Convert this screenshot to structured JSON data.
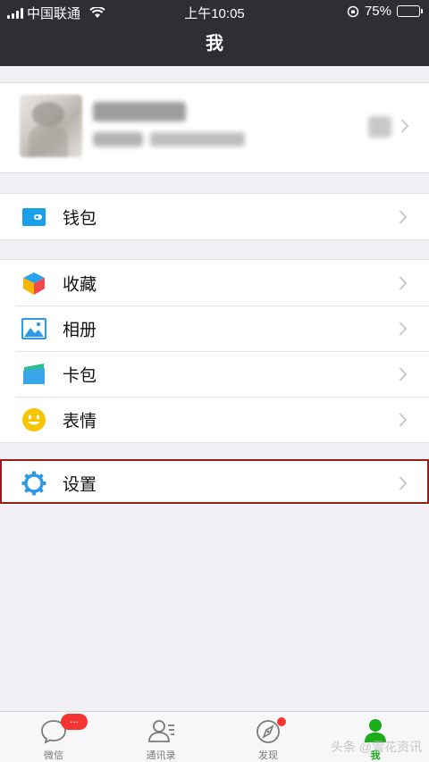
{
  "status_bar": {
    "carrier": "中国联通",
    "time": "上午10:05",
    "battery": "75%",
    "battery_level": 0.75
  },
  "nav": {
    "title": "我"
  },
  "profile": {},
  "groups": [
    {
      "items": [
        {
          "label": "钱包",
          "icon": "wallet-icon"
        }
      ]
    },
    {
      "items": [
        {
          "label": "收藏",
          "icon": "favorites-cube-icon"
        },
        {
          "label": "相册",
          "icon": "album-picture-icon"
        },
        {
          "label": "卡包",
          "icon": "card-holder-icon"
        },
        {
          "label": "表情",
          "icon": "smiley-face-icon"
        }
      ]
    },
    {
      "items": [
        {
          "label": "设置",
          "icon": "settings-gear-icon"
        }
      ]
    }
  ],
  "tabs": [
    {
      "label": "微信",
      "icon": "chat-bubble-icon",
      "badge": "..."
    },
    {
      "label": "通讯录",
      "icon": "contacts-icon"
    },
    {
      "label": "发现",
      "icon": "compass-icon"
    },
    {
      "label": "我",
      "icon": "profile-person-icon",
      "active": true
    }
  ],
  "watermark": "头条 @雪花资讯",
  "colors": {
    "accent": "#1aad19",
    "navbar": "#2e2e33",
    "badge": "#f43530",
    "highlight": "#9b1b1b"
  }
}
